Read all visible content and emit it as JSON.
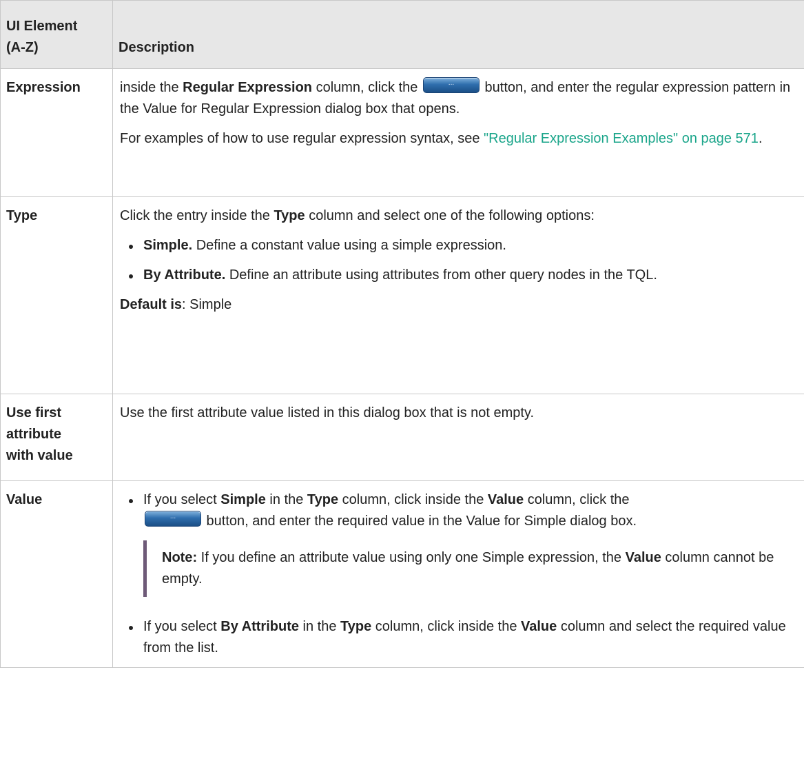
{
  "header": {
    "col1_line1": "UI Element",
    "col1_line2": "(A-Z)",
    "col2": "Description"
  },
  "button_glyph": "...",
  "rows": {
    "expression": {
      "term": "Expression",
      "p1_a": "inside the ",
      "p1_b": "Regular Expression",
      "p1_c": " column, click the ",
      "p1_d": " button, and enter the regular expression pattern in the Value for Regular Expression dialog box that opens.",
      "p2_a": "For examples of how to use regular expression syntax, see ",
      "p2_link": "\"Regular Expression Examples\" on page 571",
      "p2_c": "."
    },
    "type": {
      "term": "Type",
      "intro_a": "Click the entry inside the ",
      "intro_b": "Type",
      "intro_c": " column and select one of the following options:",
      "b1_bold": "Simple.",
      "b1_text": " Define a constant value using a simple expression.",
      "b2_bold": "By Attribute.",
      "b2_text": " Define an attribute using attributes from other query nodes in the TQL.",
      "default_bold": "Default is",
      "default_text": ": Simple"
    },
    "use_first": {
      "term_l1": "Use first",
      "term_l2": "attribute",
      "term_l3": "with value",
      "desc": "Use the first attribute value listed in this dialog box that is not empty."
    },
    "value": {
      "term": "Value",
      "b1_a": "If you select ",
      "b1_b": "Simple",
      "b1_c": " in the ",
      "b1_d": "Type",
      "b1_e": " column, click inside the ",
      "b1_f": "Value",
      "b1_g": " column, click the ",
      "b1_h": " button, and enter the required value in the Value for Simple dialog box.",
      "note_label": "Note:",
      "note_a": "  If you define an attribute value using only one Simple expression, the ",
      "note_b": "Value",
      "note_c": " column cannot be empty.",
      "b2_a": "If you select ",
      "b2_b": "By Attribute",
      "b2_c": " in the ",
      "b2_d": "Type",
      "b2_e": " column, click inside the ",
      "b2_f": "Value",
      "b2_g": " column and select the required value from the list."
    }
  }
}
